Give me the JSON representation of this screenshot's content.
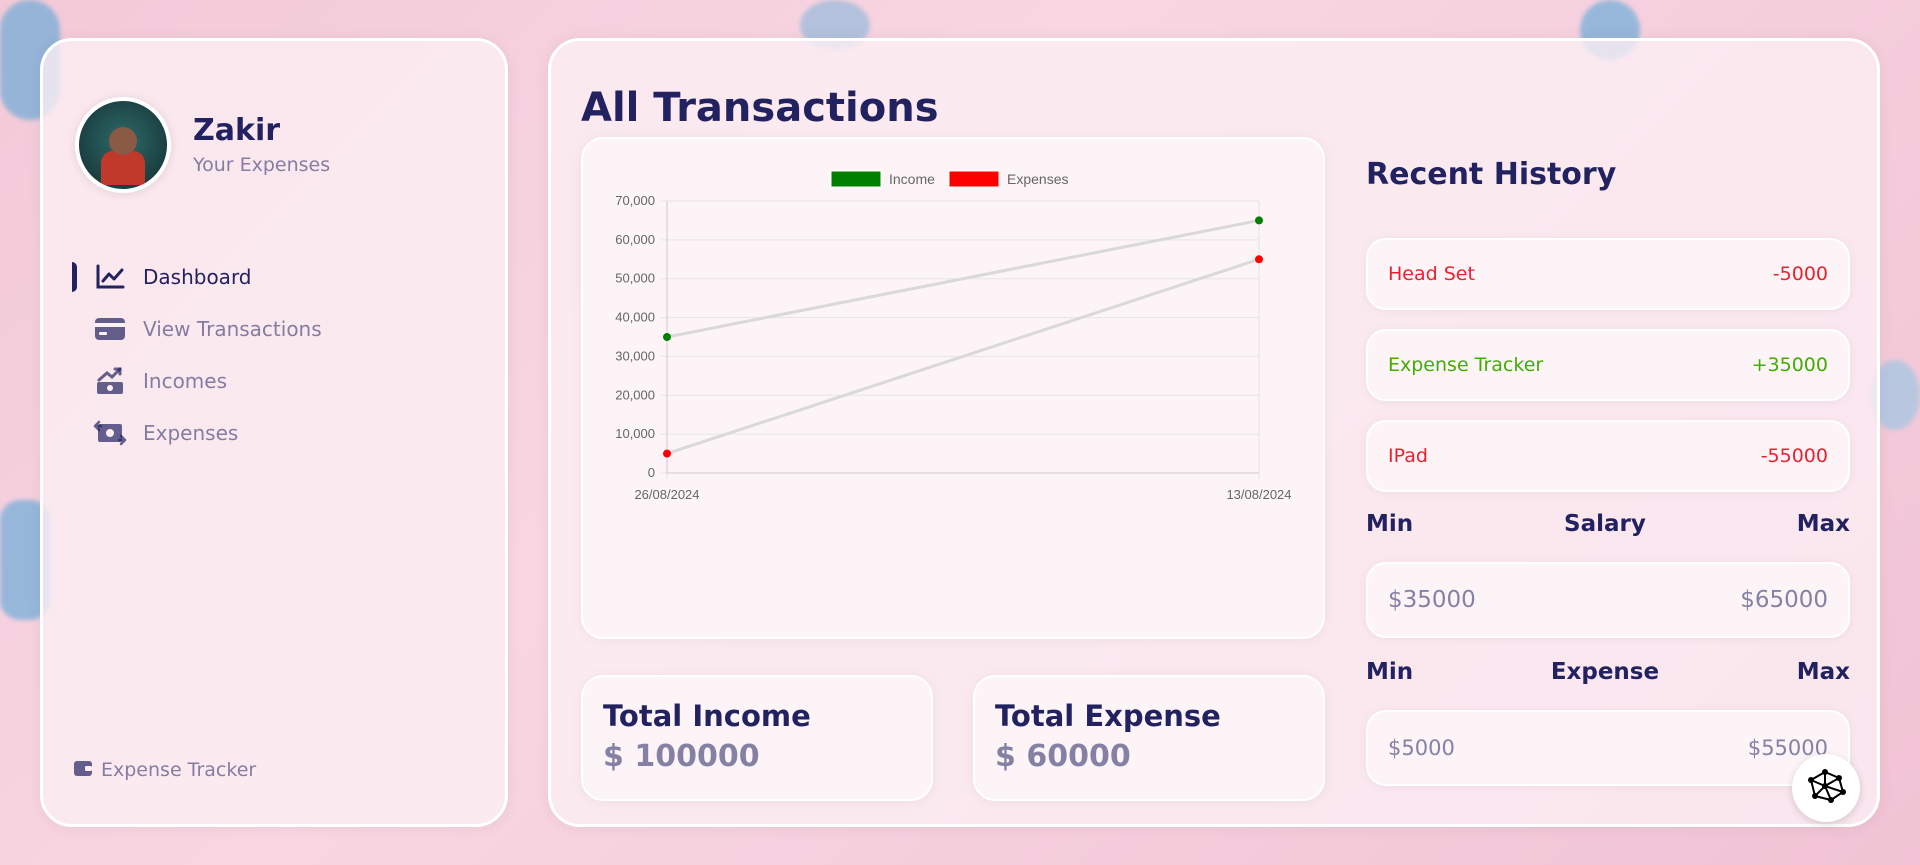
{
  "profile": {
    "name": "Zakir",
    "subtitle": "Your Expenses"
  },
  "nav": [
    {
      "label": "Dashboard",
      "icon": "chart-line-icon",
      "active": true
    },
    {
      "label": "View Transactions",
      "icon": "credit-card-icon",
      "active": false
    },
    {
      "label": "Incomes",
      "icon": "money-trend-icon",
      "active": false
    },
    {
      "label": "Expenses",
      "icon": "money-exchange-icon",
      "active": false
    }
  ],
  "footer": {
    "label": "Expense Tracker",
    "icon": "wallet-icon"
  },
  "main": {
    "title": "All Transactions"
  },
  "chart_data": {
    "type": "line",
    "x": [
      "26/08/2024",
      "13/08/2024"
    ],
    "series": [
      {
        "name": "Income",
        "values": [
          35000,
          65000
        ],
        "color": "#008000"
      },
      {
        "name": "Expenses",
        "values": [
          5000,
          55000
        ],
        "color": "#ff0000"
      }
    ],
    "yticks": [
      "0",
      "10,000",
      "20,000",
      "30,000",
      "40,000",
      "50,000",
      "60,000",
      "70,000"
    ],
    "ylim": [
      0,
      70000
    ],
    "legend_position": "top",
    "grid": true,
    "line_color": "#d9d9d9"
  },
  "totals": {
    "income_title": "Total Income",
    "income_value": "$ 100000",
    "expense_title": "Total Expense",
    "expense_value": "$ 60000"
  },
  "history": {
    "title": "Recent History",
    "items": [
      {
        "name": "Head Set",
        "amount": "-5000",
        "type": "expense"
      },
      {
        "name": "Expense Tracker",
        "amount": "+35000",
        "type": "income"
      },
      {
        "name": "IPad",
        "amount": "-55000",
        "type": "expense"
      }
    ]
  },
  "salary_range": {
    "min_label": "Min",
    "title": "Salary",
    "max_label": "Max",
    "min_value": "$35000",
    "max_value": "$65000"
  },
  "expense_range": {
    "min_label": "Min",
    "title": "Expense",
    "max_label": "Max",
    "min_value": "$5000",
    "max_value": "$55000"
  },
  "fab": {
    "icon": "network-graph-icon"
  },
  "colors": {
    "primary": "#222260",
    "muted": "rgba(34,34,96,0.55)",
    "income": "#42ad00",
    "expense": "#e8232f"
  }
}
